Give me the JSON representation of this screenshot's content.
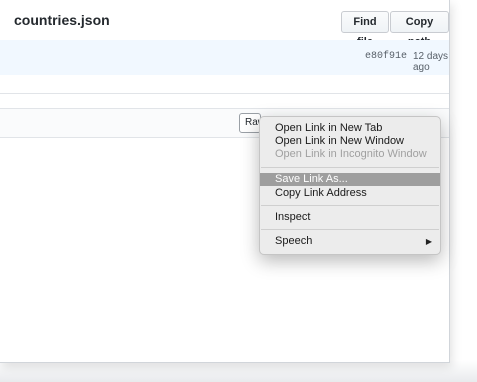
{
  "header": {
    "file_name": "countries.json",
    "find_file": "Find file",
    "copy_path": "Copy path"
  },
  "commit": {
    "sha": "e80f91e",
    "time": "12 days ago"
  },
  "toolbar": {
    "raw_label": "Raw"
  },
  "context_menu": {
    "items": [
      {
        "label": "Open Link in New Tab",
        "enabled": true
      },
      {
        "label": "Open Link in New Window",
        "enabled": true
      },
      {
        "label": "Open Link in Incognito Window",
        "enabled": false
      },
      {
        "label": "Save Link As...",
        "enabled": true,
        "highlighted": true
      },
      {
        "label": "Copy Link Address",
        "enabled": true
      },
      {
        "label": "Inspect",
        "enabled": true
      },
      {
        "label": "Speech",
        "enabled": true,
        "submenu": true
      }
    ]
  },
  "colors": {
    "commit_bar_bg": "#f1f8ff",
    "menu_highlight": "#9e9e9e"
  },
  "icons": {
    "submenu": "triangle-right-icon"
  }
}
